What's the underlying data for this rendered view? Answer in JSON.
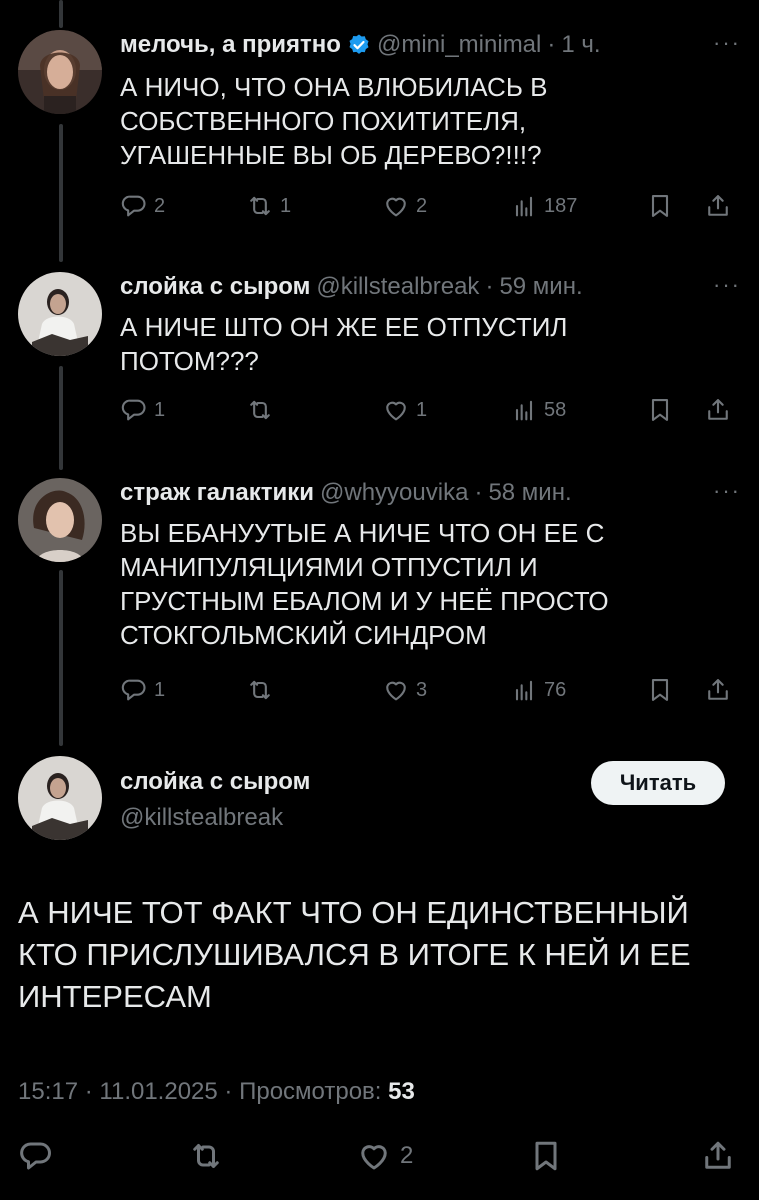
{
  "thread": [
    {
      "name": "мелочь, а приятно",
      "verified": true,
      "handle": "@mini_minimal",
      "time": "1 ч.",
      "text": "А НИЧО, ЧТО ОНА ВЛЮБИЛАСЬ В\nСОБСТВЕННОГО ПОХИТИТЕЛЯ,\nУГАШЕННЫЕ ВЫ ОБ ДЕРЕВО?!!!?",
      "replies": "2",
      "reposts": "1",
      "likes": "2",
      "views": "187"
    },
    {
      "name": "слойка с сыром",
      "handle": "@killstealbreak",
      "time": "59 мин.",
      "text": "А НИЧЕ ШТО ОН ЖЕ ЕЕ ОТПУСТИЛ\nПОТОМ???",
      "replies": "1",
      "reposts": "",
      "likes": "1",
      "views": "58"
    },
    {
      "name": "страж галактики",
      "handle": "@whyyouvika",
      "time": "58 мин.",
      "text": "ВЫ ЕБАНУУТЫЕ А НИЧЕ ЧТО ОН ЕЕ С\nМАНИПУЛЯЦИЯМИ ОТПУСТИЛ И\nГРУСТНЫМ ЕБАЛОМ И У НЕЁ ПРОСТО\nСТОКГОЛЬМСКИЙ СИНДРОМ",
      "replies": "1",
      "reposts": "",
      "likes": "3",
      "views": "76"
    }
  ],
  "main": {
    "name": "слойка с сыром",
    "handle": "@killstealbreak",
    "follow_label": "Читать",
    "text": "А НИЧЕ ТОТ ФАКТ ЧТО ОН ЕДИНСТВЕННЫЙ\nКТО ПРИСЛУШИВАЛСЯ В ИТОГЕ К НЕЙ И ЕЕ\nИНТЕРЕСАМ",
    "time": "15:17",
    "date": "11.01.2025",
    "views_label": "Просмотров:",
    "views": "53",
    "likes": "2"
  },
  "separator": "·",
  "more": "···",
  "icons": [
    "reply-icon",
    "repost-icon",
    "like-icon",
    "views-icon",
    "bookmark-icon",
    "share-icon",
    "verified-badge-icon"
  ],
  "colors": {
    "background": "#000000",
    "text": "#e7e9ea",
    "muted": "#71767b",
    "verified": "#1d9bf0",
    "button": "#eff3f4"
  }
}
